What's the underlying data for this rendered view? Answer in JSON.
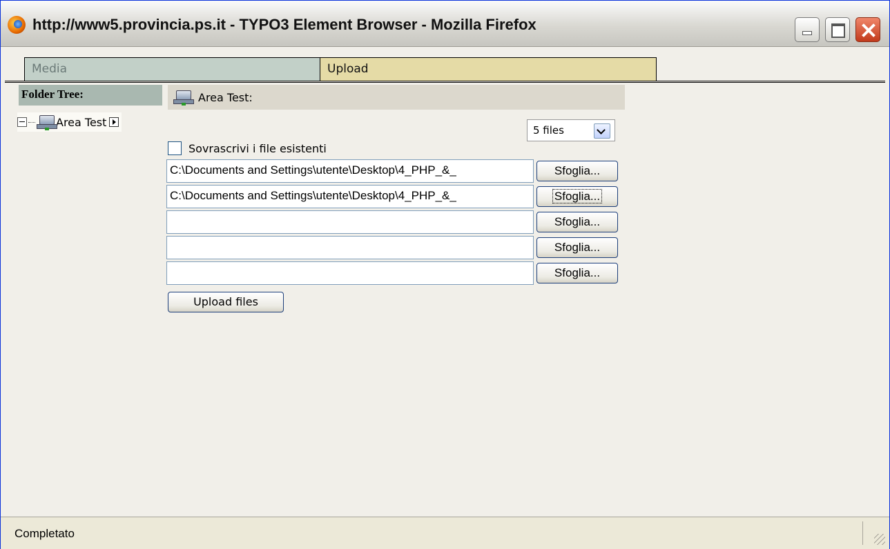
{
  "window": {
    "title": "http://www5.provincia.ps.it - TYPO3 Element Browser - Mozilla Firefox",
    "icon": "firefox-icon",
    "buttons": [
      "minimize",
      "maximize",
      "close"
    ]
  },
  "tabs": [
    {
      "label": "Media",
      "active": false
    },
    {
      "label": "Upload",
      "active": true
    }
  ],
  "folder_tree": {
    "header": "Folder Tree:",
    "items": [
      {
        "label": "Area Test",
        "icon": "drive-icon"
      }
    ]
  },
  "main": {
    "folder_header": "Area Test:",
    "files_select": {
      "value": "5 files"
    },
    "overwrite_label": "Sovrascrivi i file esistenti",
    "overwrite_checked": false,
    "file_inputs": [
      {
        "value": "C:\\Documents and Settings\\utente\\Desktop\\4_PHP_&_"
      },
      {
        "value": "C:\\Documents and Settings\\utente\\Desktop\\4_PHP_&_"
      },
      {
        "value": ""
      },
      {
        "value": ""
      },
      {
        "value": ""
      }
    ],
    "browse_label": "Sfoglia...",
    "upload_label": "Upload files"
  },
  "status": {
    "text": "Completato"
  }
}
